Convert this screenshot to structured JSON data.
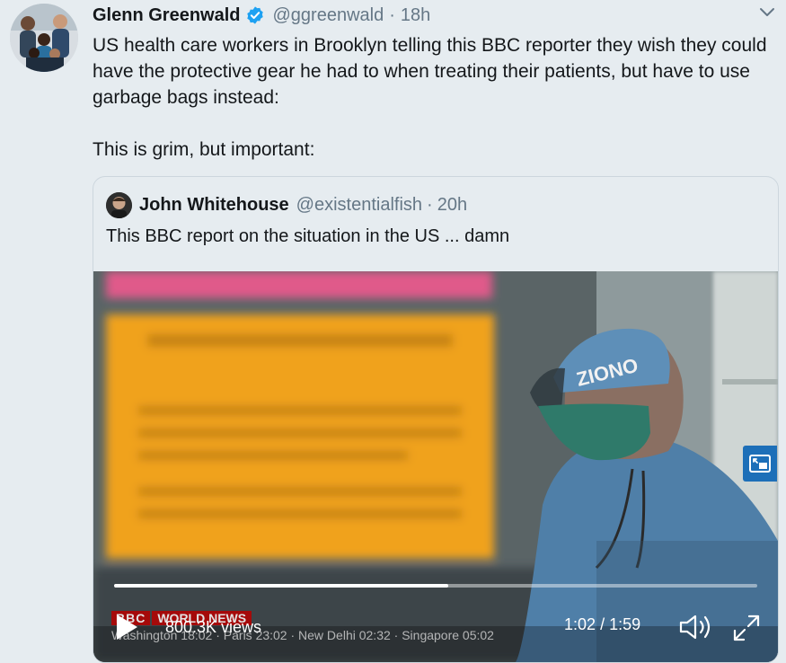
{
  "tweet": {
    "author_name": "Glenn Greenwald",
    "handle": "@ggreenwald",
    "separator": "·",
    "time": "18h",
    "text_line1": "US health care workers in Brooklyn telling this BBC reporter they wish they could have the protective gear he had to when treating their patients, but have to use garbage bags instead:",
    "text_line2": "This is grim, but important:",
    "verified_color": "#1da1f2"
  },
  "quoted_tweet": {
    "author_name": "John Whitehouse",
    "handle": "@existentialfish",
    "separator": "·",
    "time": "20h",
    "text": "This BBC report on the situation in the US ... damn"
  },
  "video": {
    "views": "800.3K views",
    "current_time": "1:02",
    "time_separator": "/",
    "duration": "1:59",
    "progress_fraction": 0.52,
    "overlay_brand": "BBC",
    "overlay_channel": "WORLD NEWS",
    "overlay_ticker": "Washington 18:02 · Paris 23:02 · New Delhi 02:32 · Singapore 05:02",
    "mask_text": "ZIONO"
  },
  "icons": {
    "verified": "verified-badge-icon",
    "caret": "chevron-down-icon",
    "play": "play-icon",
    "volume": "volume-icon",
    "expand": "fullscreen-icon",
    "pip": "picture-in-picture-icon"
  }
}
